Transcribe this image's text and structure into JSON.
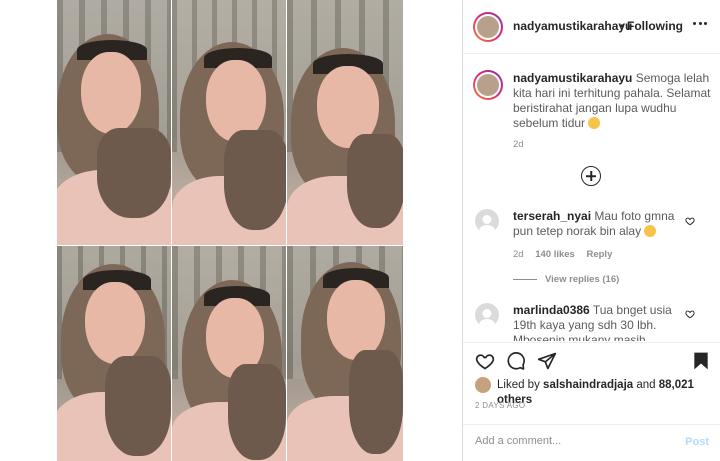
{
  "post": {
    "username": "nadyamustikarahayu",
    "separator": "•",
    "follow_state": "Following",
    "caption": "Semoga lelah kita hari ini terhitung pahala. Selamat beristirahat jangan lupa wudhu sebelum tidur",
    "caption_age": "2d"
  },
  "comments": [
    {
      "username": "terserah_nyai",
      "text": "Mau foto gmna pun tetep norak bin alay",
      "age": "2d",
      "likes": "140 likes",
      "reply_label": "Reply",
      "view_replies": "View replies (16)"
    },
    {
      "username": "marlinda0386",
      "text": "Tua bnget usia 19th kaya yang sdh 30 lbh. Mbosenin mukany masih"
    }
  ],
  "likes": {
    "prefix": "Liked by",
    "user": "salshaindradjaja",
    "and": "and",
    "count": "88,021 others"
  },
  "timestamp": "2 DAYS AGO",
  "add_comment": {
    "placeholder": "Add a comment...",
    "post_label": "Post"
  },
  "icons": {
    "more": "more-options-icon",
    "add": "plus-circle-icon",
    "like": "heart-icon",
    "comment": "comment-bubble-icon",
    "share": "paper-plane-icon",
    "save": "bookmark-icon",
    "comment_like": "small-heart-icon"
  },
  "colors": {
    "text": "#262626",
    "muted": "#8e8e8e",
    "border": "#dbdbdb",
    "post_disabled": "#b3dbff"
  }
}
